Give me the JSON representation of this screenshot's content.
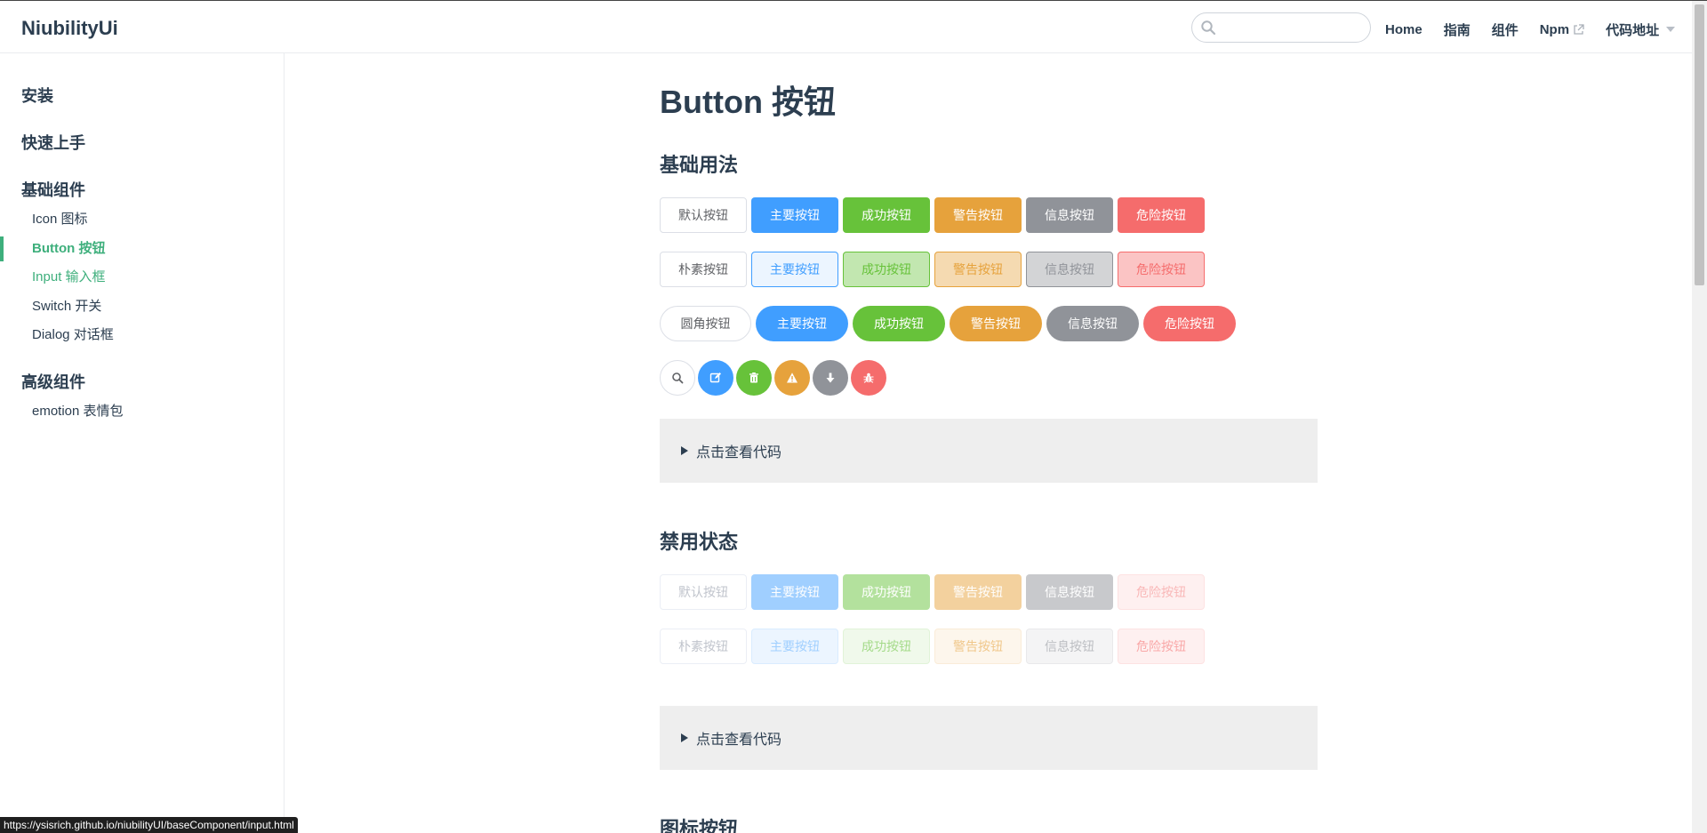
{
  "navbar": {
    "brand": "NiubilityUi",
    "search": {
      "value": "",
      "placeholder": ""
    },
    "links": [
      "Home",
      "指南",
      "组件",
      "Npm",
      "代码地址"
    ]
  },
  "sidebar": {
    "groups": [
      {
        "title": "安装"
      },
      {
        "title": "快速上手"
      },
      {
        "title": "基础组件",
        "items": [
          "Icon 图标",
          "Button 按钮",
          "Input 输入框",
          "Switch 开关",
          "Dialog 对话框"
        ]
      },
      {
        "title": "高级组件",
        "items": [
          "emotion 表情包"
        ]
      }
    ]
  },
  "content": {
    "title": "Button 按钮",
    "sections": [
      {
        "title": "基础用法",
        "rows": {
          "basic": [
            "默认按钮",
            "主要按钮",
            "成功按钮",
            "警告按钮",
            "信息按钮",
            "危险按钮"
          ],
          "plain": [
            "朴素按钮",
            "主要按钮",
            "成功按钮",
            "警告按钮",
            "信息按钮",
            "危险按钮"
          ],
          "round": [
            "圆角按钮",
            "主要按钮",
            "成功按钮",
            "警告按钮",
            "信息按钮",
            "危险按钮"
          ],
          "circle_icons": [
            "search-icon",
            "edit-icon",
            "delete-icon",
            "warning-icon",
            "download-icon",
            "bug-icon"
          ]
        },
        "code_toggle": "点击查看代码"
      },
      {
        "title": "禁用状态",
        "rows": {
          "basic": [
            "默认按钮",
            "主要按钮",
            "成功按钮",
            "警告按钮",
            "信息按钮",
            "危险按钮"
          ],
          "plain": [
            "朴素按钮",
            "主要按钮",
            "成功按钮",
            "警告按钮",
            "信息按钮",
            "危险按钮"
          ]
        },
        "code_toggle": "点击查看代码"
      },
      {
        "title": "图标按钮"
      }
    ]
  },
  "status_bar": {
    "url": "https://ysisrich.github.io/niubilityUI/baseComponent/input.html"
  },
  "colors": {
    "accent": "#3eaf7c",
    "primary": "#409eff",
    "success": "#67c23a",
    "warning": "#e6a23c",
    "info": "#909399",
    "danger": "#f56c6c"
  }
}
